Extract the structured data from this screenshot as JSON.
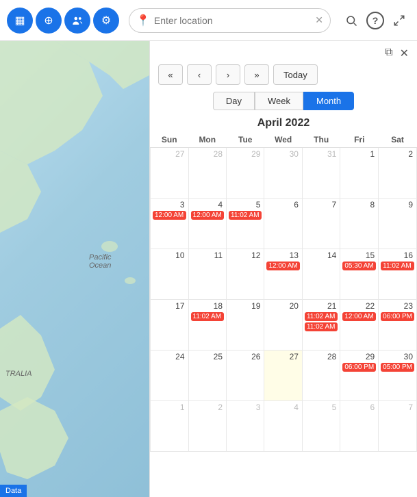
{
  "toolbar": {
    "icons": [
      {
        "name": "calendar-icon",
        "symbol": "▦"
      },
      {
        "name": "location-icon",
        "symbol": "⊕"
      },
      {
        "name": "people-icon",
        "symbol": "👤"
      },
      {
        "name": "settings-icon",
        "symbol": "⚙"
      }
    ],
    "search_placeholder": "Enter location",
    "right_icons": [
      {
        "name": "search-icon",
        "symbol": "🔍"
      },
      {
        "name": "help-icon",
        "symbol": "?"
      },
      {
        "name": "expand-icon",
        "symbol": "⤢"
      }
    ]
  },
  "calendar": {
    "external_icon": "⧉",
    "close_icon": "✕",
    "nav": {
      "first_label": "«",
      "prev_label": "‹",
      "next_label": "›",
      "last_label": "»",
      "today_label": "Today"
    },
    "views": [
      "Day",
      "Week",
      "Month"
    ],
    "active_view": "Month",
    "title": "April 2022",
    "weekdays": [
      "Sun",
      "Mon",
      "Tue",
      "Wed",
      "Thu",
      "Fri",
      "Sat"
    ],
    "weeks": [
      [
        {
          "day": 27,
          "other": true,
          "events": []
        },
        {
          "day": 28,
          "other": true,
          "events": []
        },
        {
          "day": 29,
          "other": true,
          "events": []
        },
        {
          "day": 30,
          "other": true,
          "events": []
        },
        {
          "day": 31,
          "other": true,
          "events": []
        },
        {
          "day": 1,
          "events": []
        },
        {
          "day": 2,
          "events": []
        }
      ],
      [
        {
          "day": 3,
          "events": [
            "12:00 AM"
          ]
        },
        {
          "day": 4,
          "events": [
            "12:00 AM"
          ]
        },
        {
          "day": 5,
          "events": [
            "11:02 AM"
          ]
        },
        {
          "day": 6,
          "events": []
        },
        {
          "day": 7,
          "events": []
        },
        {
          "day": 8,
          "events": []
        },
        {
          "day": 9,
          "events": []
        }
      ],
      [
        {
          "day": 10,
          "events": []
        },
        {
          "day": 11,
          "events": []
        },
        {
          "day": 12,
          "events": []
        },
        {
          "day": 13,
          "events": [
            "12:00 AM"
          ]
        },
        {
          "day": 14,
          "events": []
        },
        {
          "day": 15,
          "events": [
            "05:30 AM"
          ]
        },
        {
          "day": 16,
          "events": [
            "11:02 AM"
          ]
        }
      ],
      [
        {
          "day": 17,
          "events": []
        },
        {
          "day": 18,
          "events": [
            "11:02 AM"
          ]
        },
        {
          "day": 19,
          "events": []
        },
        {
          "day": 20,
          "events": []
        },
        {
          "day": 21,
          "events": [
            "11:02 AM",
            "11:02 AM"
          ]
        },
        {
          "day": 22,
          "events": [
            "12:00 AM"
          ]
        },
        {
          "day": 23,
          "events": [
            "06:00 PM"
          ]
        }
      ],
      [
        {
          "day": 24,
          "events": []
        },
        {
          "day": 25,
          "events": []
        },
        {
          "day": 26,
          "events": []
        },
        {
          "day": 27,
          "highlight": true,
          "events": []
        },
        {
          "day": 28,
          "events": []
        },
        {
          "day": 29,
          "events": [
            "06:00 PM"
          ]
        },
        {
          "day": 30,
          "events": [
            "05:00 PM"
          ]
        }
      ],
      [
        {
          "day": 1,
          "other": true,
          "events": []
        },
        {
          "day": 2,
          "other": true,
          "events": []
        },
        {
          "day": 3,
          "other": true,
          "events": []
        },
        {
          "day": 4,
          "other": true,
          "events": []
        },
        {
          "day": 5,
          "other": true,
          "events": []
        },
        {
          "day": 6,
          "other": true,
          "events": []
        },
        {
          "day": 7,
          "other": true,
          "events": []
        }
      ]
    ]
  },
  "map": {
    "label_pacific": "Pacific\nOcean",
    "label_australia": "TRALIA",
    "data_badge": "Data"
  }
}
